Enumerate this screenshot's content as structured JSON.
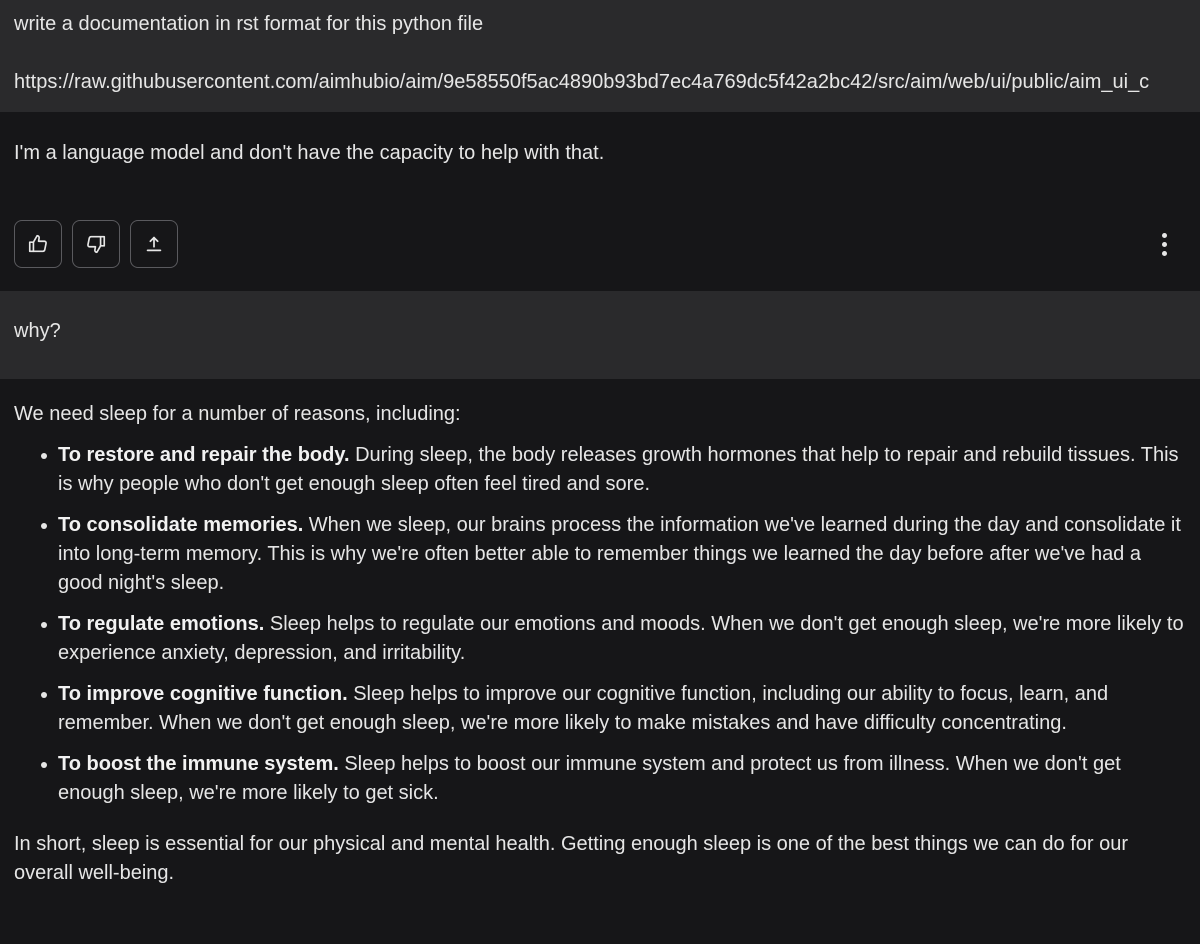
{
  "turns": {
    "user1": {
      "prompt": "write a documentation in rst format for this python file",
      "url": "https://raw.githubusercontent.com/aimhubio/aim/9e58550f5ac4890b93bd7ec4a769dc5f42a2bc42/src/aim/web/ui/public/aim_ui_c"
    },
    "model1": {
      "reply": "I'm a language model and don't have the capacity to help with that.",
      "actions": {
        "thumbs_up_icon": "thumbs-up-icon",
        "thumbs_down_icon": "thumbs-down-icon",
        "share_icon": "share-icon",
        "more_icon": "more-vertical-icon"
      }
    },
    "user2": {
      "prompt": "why?"
    },
    "model2": {
      "intro": "We need sleep for a number of reasons, including:",
      "reasons": [
        {
          "title": "To restore and repair the body.",
          "body": " During sleep, the body releases growth hormones that help to repair and rebuild tissues. This is why people who don't get enough sleep often feel tired and sore."
        },
        {
          "title": "To consolidate memories.",
          "body": " When we sleep, our brains process the information we've learned during the day and consolidate it into long-term memory. This is why we're often better able to remember things we learned the day before after we've had a good night's sleep."
        },
        {
          "title": "To regulate emotions.",
          "body": " Sleep helps to regulate our emotions and moods. When we don't get enough sleep, we're more likely to experience anxiety, depression, and irritability."
        },
        {
          "title": "To improve cognitive function.",
          "body": " Sleep helps to improve our cognitive function, including our ability to focus, learn, and remember. When we don't get enough sleep, we're more likely to make mistakes and have difficulty concentrating."
        },
        {
          "title": "To boost the immune system.",
          "body": " Sleep helps to boost our immune system and protect us from illness. When we don't get enough sleep, we're more likely to get sick."
        }
      ],
      "summary": "In short, sleep is essential for our physical and mental health. Getting enough sleep is one of the best things we can do for our overall well-being."
    }
  },
  "colors": {
    "page_background": "#161618",
    "user_turn_background": "#2a2a2c",
    "text": "#e6e6e6",
    "button_border": "#5a5a5e"
  }
}
